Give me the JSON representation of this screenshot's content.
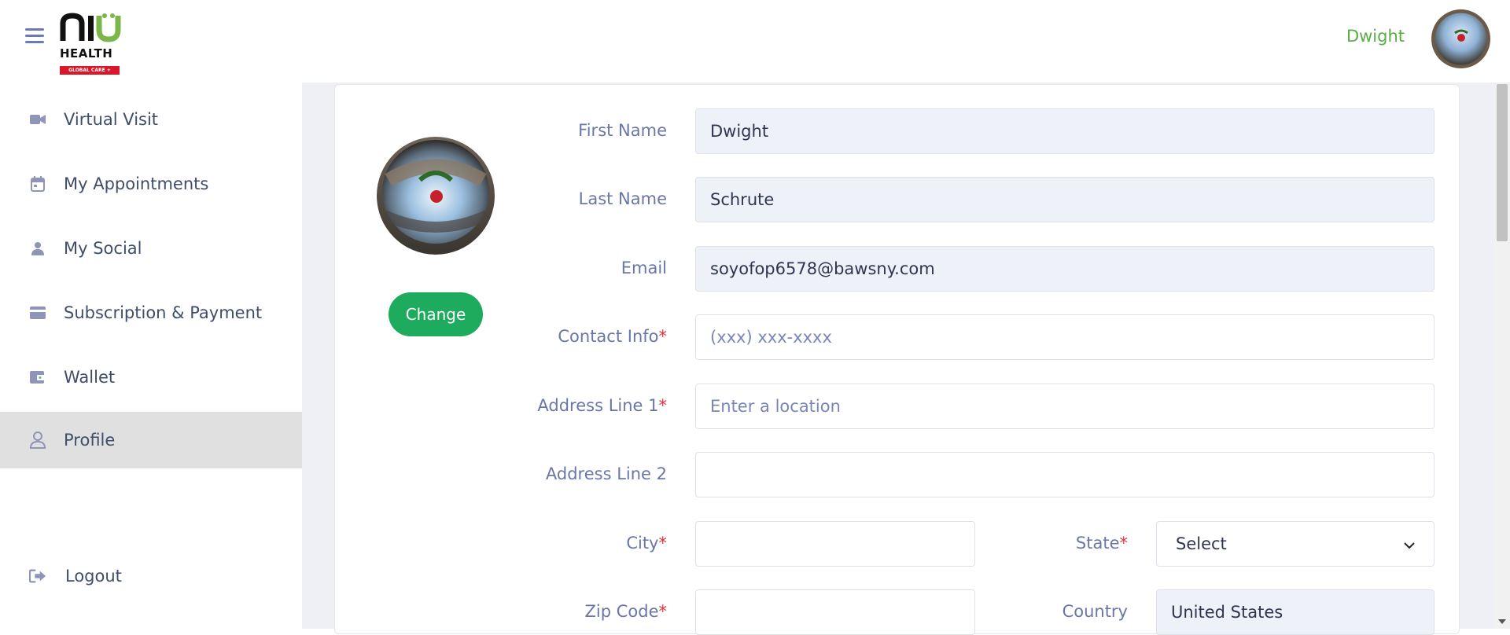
{
  "header": {
    "logo": {
      "brand": "nu",
      "health": "HEALTH",
      "tagline": "GLOBAL CARE +"
    },
    "user_name": "Dwight"
  },
  "sidebar": {
    "items": [
      {
        "label": "Virtual Visit",
        "icon": "video-camera-icon"
      },
      {
        "label": "My Appointments",
        "icon": "calendar-icon"
      },
      {
        "label": "My Social",
        "icon": "person-icon"
      },
      {
        "label": "Subscription & Payment",
        "icon": "credit-card-icon"
      },
      {
        "label": "Wallet",
        "icon": "wallet-icon"
      },
      {
        "label": "Profile",
        "icon": "user-outline-icon",
        "active": true
      }
    ],
    "logout": {
      "label": "Logout",
      "icon": "sign-out-icon"
    }
  },
  "profile": {
    "change_label": "Change",
    "fields": {
      "first_name": {
        "label": "First Name",
        "value": "Dwight"
      },
      "last_name": {
        "label": "Last Name",
        "value": "Schrute"
      },
      "email": {
        "label": "Email",
        "value": "soyofop6578@bawsny.com"
      },
      "contact": {
        "label": "Contact Info",
        "placeholder": "(xxx) xxx-xxxx",
        "required": "*"
      },
      "address1": {
        "label": "Address Line 1",
        "placeholder": "Enter a location",
        "required": "*"
      },
      "address2": {
        "label": "Address Line 2"
      },
      "city": {
        "label": "City",
        "required": "*"
      },
      "state": {
        "label": "State",
        "value": "Select",
        "required": "*"
      },
      "zip": {
        "label": "Zip Code",
        "required": "*"
      },
      "country": {
        "label": "Country",
        "value": "United States"
      }
    }
  },
  "colors": {
    "accent_green": "#1fab5e",
    "user_green": "#5aac44",
    "label_blue": "#6b76a8",
    "required_red": "#e0303a"
  }
}
